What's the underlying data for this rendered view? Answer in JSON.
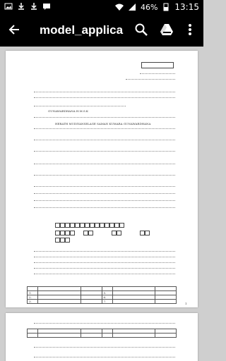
{
  "status": {
    "left_icons": [
      "image-icon",
      "download-icon",
      "download-icon",
      "message-icon"
    ],
    "battery": "46%",
    "time": "13:15"
  },
  "toolbar": {
    "title": "model_applica…",
    "back_icon": "arrow-left-icon",
    "search_icon": "search-icon",
    "drive_icon": "google-drive-icon",
    "more_icon": "more-vert-icon"
  },
  "document": {
    "names": [
      "GUNAWARDHANA H.M.S.K",
      "HERATH MUDIYANSELAGE SAMAN KUMARA GUNAWARDHANA"
    ],
    "page_number": "1",
    "table_rows": [
      "1.",
      "2.",
      "3.",
      "4."
    ],
    "table_rows_right": [
      "5.",
      "6.",
      "7.",
      "8."
    ]
  }
}
